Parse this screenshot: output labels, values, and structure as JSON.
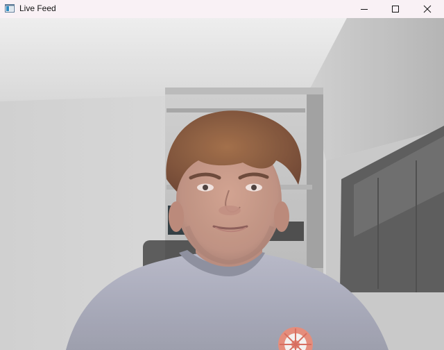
{
  "window": {
    "title": "Live Feed",
    "icon": "app-window-icon",
    "controls": {
      "minimize_icon": "minimize-icon",
      "maximize_icon": "maximize-icon",
      "close_icon": "close-icon"
    }
  },
  "feed": {
    "description_icon": "camera-frame",
    "colors": {
      "titlebar": "#f9f1f5",
      "wall": "#d6d6d6",
      "shirt": "#a8aab8",
      "hair": "#8a5a3a",
      "skin": "#c99a86",
      "badge": "#e58a78"
    }
  }
}
